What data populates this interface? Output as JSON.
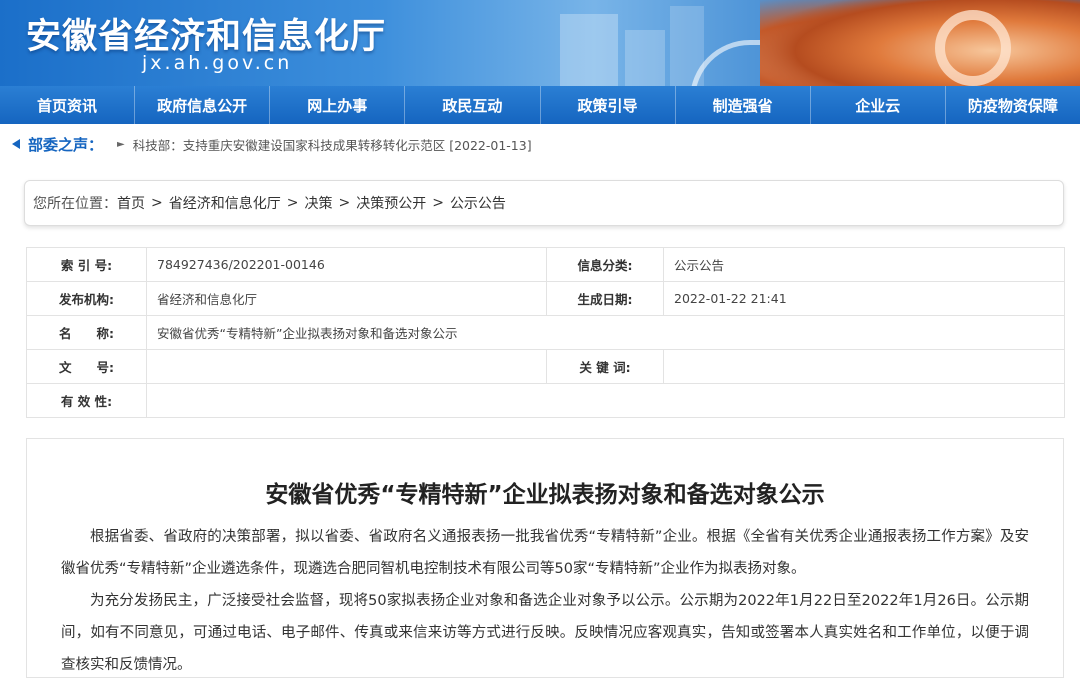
{
  "banner": {
    "title": "安徽省经济和信息化厅",
    "domain": "jx.ah.gov.cn"
  },
  "nav": [
    "首页资讯",
    "政府信息公开",
    "网上办事",
    "政民互动",
    "政策引导",
    "制造强省",
    "企业云",
    "防疫物资保障"
  ],
  "notice": {
    "label": "部委之声：",
    "text": "科技部：支持重庆安徽建设国家科技成果转移转化示范区 [2022-01-13]"
  },
  "breadcrumb": {
    "label": "您所在位置：",
    "items": [
      "首页",
      "省经济和信息化厅",
      "决策",
      "决策预公开",
      "公示公告"
    ]
  },
  "info": {
    "index_label": "索 引 号:",
    "index_value": "784927436/202201-00146",
    "category_label": "信息分类:",
    "category_value": "公示公告",
    "publisher_label": "发布机构:",
    "publisher_value": "省经济和信息化厅",
    "date_label": "生成日期:",
    "date_value": "2022-01-22 21:41",
    "name_label": "名　　称:",
    "name_value": "安徽省优秀“专精特新”企业拟表扬对象和备选对象公示",
    "docno_label": "文　　号:",
    "docno_value": "",
    "keyword_label": "关 键 词:",
    "keyword_value": "",
    "validity_label": "有 效 性:",
    "validity_value": ""
  },
  "article": {
    "title": "安徽省优秀“专精特新”企业拟表扬对象和备选对象公示",
    "paragraphs": [
      "根据省委、省政府的决策部署，拟以省委、省政府名义通报表扬一批我省优秀“专精特新”企业。根据《全省有关优秀企业通报表扬工作方案》及安徽省优秀“专精特新”企业遴选条件，现遴选合肥同智机电控制技术有限公司等50家“专精特新”企业作为拟表扬对象。",
      "为充分发扬民主，广泛接受社会监督，现将50家拟表扬企业对象和备选企业对象予以公示。公示期为2022年1月22日至2022年1月26日。公示期间，如有不同意见，可通过电话、电子邮件、传真或来信来访等方式进行反映。反映情况应客观真实，告知或签署本人真实姓名和工作单位，以便于调查核实和反馈情况。"
    ]
  }
}
